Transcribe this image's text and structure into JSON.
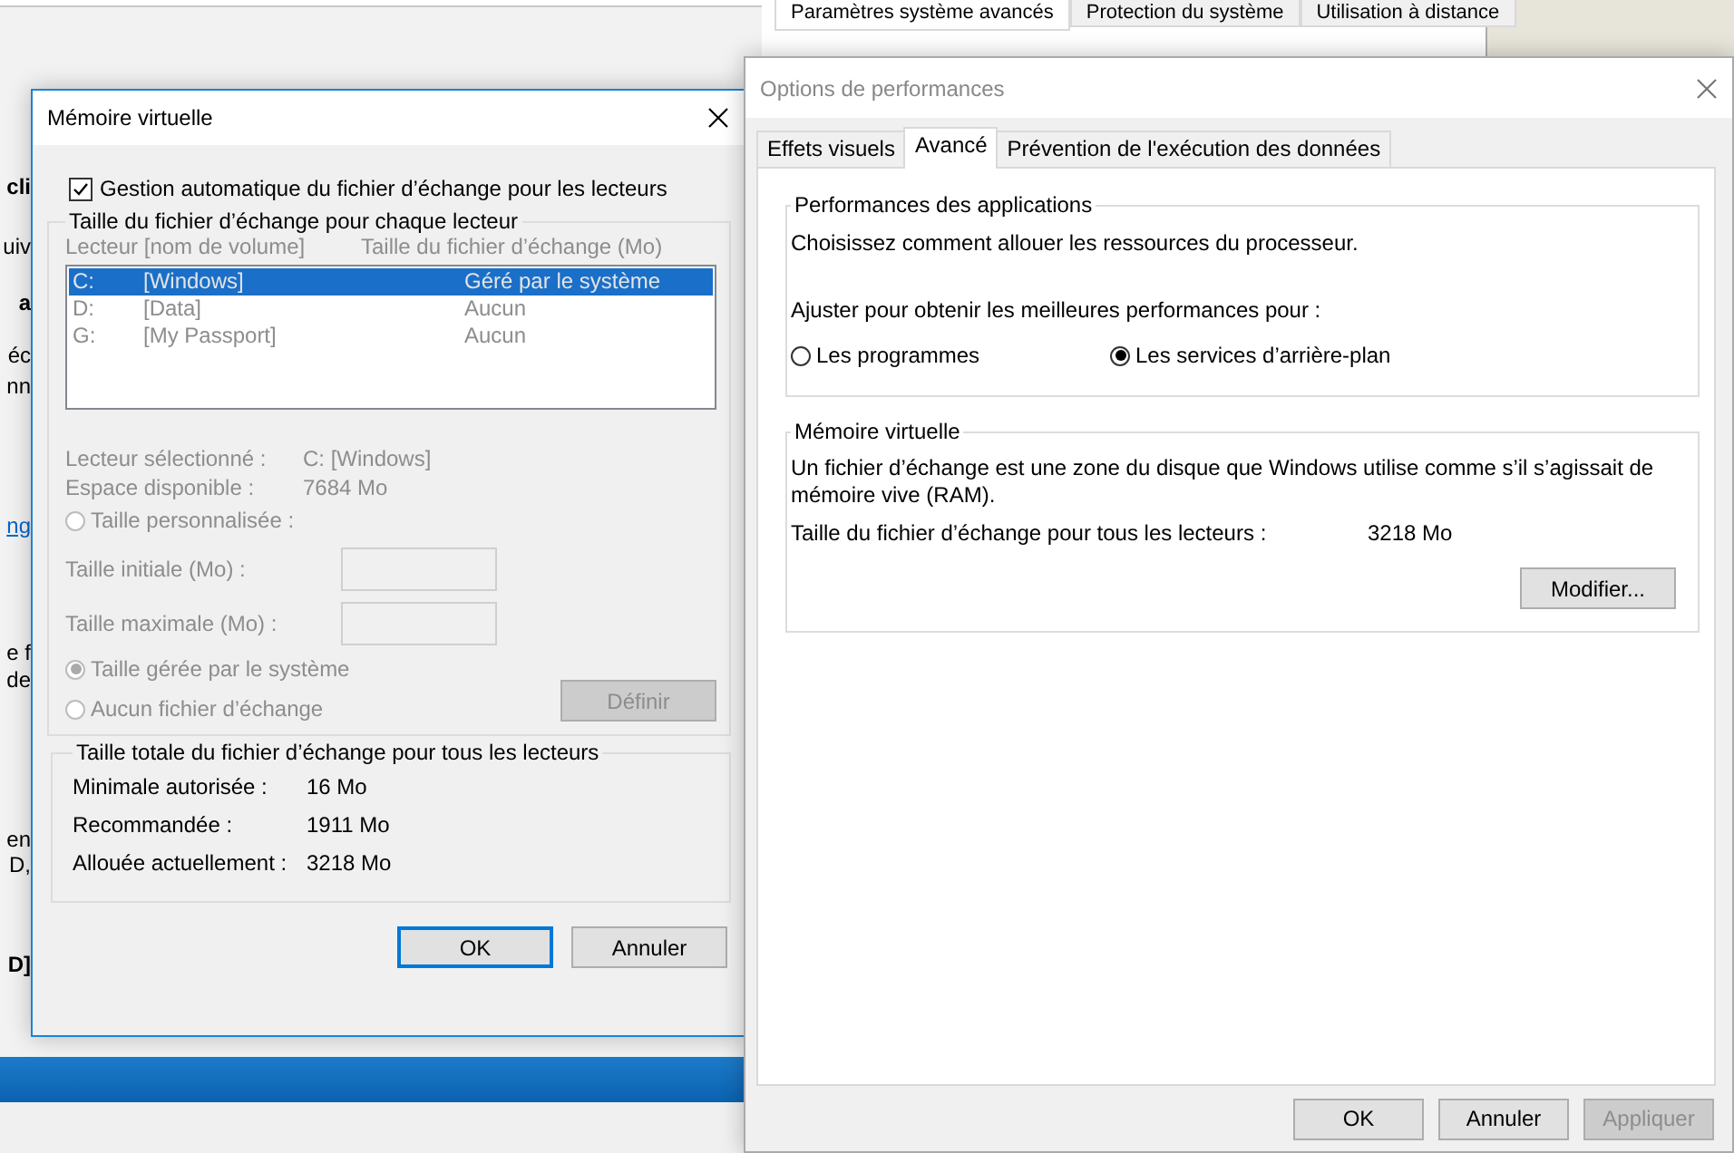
{
  "background_window": {
    "tabs": [
      {
        "label": "Paramètres système avancés",
        "selected": true
      },
      {
        "label": "Protection du système",
        "selected": false
      },
      {
        "label": "Utilisation à distance",
        "selected": false
      }
    ],
    "cut_texts": [
      {
        "text": "cli",
        "kind": "bold"
      },
      {
        "text": "uiv",
        "kind": "plain"
      },
      {
        "text": "a",
        "kind": "bold"
      },
      {
        "text": "éc",
        "kind": "plain"
      },
      {
        "text": "nn",
        "kind": "plain"
      },
      {
        "text": "ng",
        "kind": "link"
      },
      {
        "text": "e f",
        "kind": "plain"
      },
      {
        "text": "de",
        "kind": "plain"
      },
      {
        "text": "en",
        "kind": "plain"
      },
      {
        "text": "D,",
        "kind": "plain"
      },
      {
        "text": "D]",
        "kind": "bold"
      }
    ]
  },
  "virtual_memory_dialog": {
    "title": "Mémoire virtuelle",
    "auto_manage": {
      "label": "Gestion automatique du fichier d’échange pour les lecteurs",
      "checked": true
    },
    "drives_group": {
      "title": "Taille du fichier d’échange pour chaque lecteur",
      "columns": [
        "Lecteur [nom de volume]",
        "Taille du fichier d’échange (Mo)"
      ],
      "drives": [
        {
          "drive": "C:",
          "volume": "[Windows]",
          "size": "Géré par le système",
          "selected": true
        },
        {
          "drive": "D:",
          "volume": "[Data]",
          "size": "Aucun",
          "selected": false
        },
        {
          "drive": "G:",
          "volume": "[My Passport]",
          "size": "Aucun",
          "selected": false
        }
      ],
      "info": [
        {
          "label": "Lecteur sélectionné :",
          "value": "C:  [Windows]"
        },
        {
          "label": "Espace disponible :",
          "value": "7684 Mo"
        }
      ],
      "options": [
        {
          "label": "Taille personnalisée :",
          "selected": false
        },
        {
          "label": "Taille gérée par le système",
          "selected": true
        },
        {
          "label": "Aucun fichier d’échange",
          "selected": false
        }
      ],
      "size_fields": [
        {
          "label": "Taille initiale (Mo) :"
        },
        {
          "label": "Taille maximale (Mo) :"
        }
      ],
      "set_button": "Définir"
    },
    "totals_group": {
      "title": "Taille totale du fichier d’échange pour tous les lecteurs",
      "rows": [
        {
          "label": "Minimale autorisée :",
          "value": "16 Mo"
        },
        {
          "label": "Recommandée :",
          "value": "1911 Mo"
        },
        {
          "label": "Allouée actuellement :",
          "value": "3218 Mo"
        }
      ]
    },
    "buttons": [
      {
        "label": "OK",
        "default": true
      },
      {
        "label": "Annuler",
        "default": false
      }
    ]
  },
  "performance_dialog": {
    "title": "Options de performances",
    "tabs": [
      {
        "label": "Effets visuels",
        "selected": false
      },
      {
        "label": "Avancé",
        "selected": true
      },
      {
        "label": "Prévention de l'exécution des données",
        "selected": false
      }
    ],
    "app_group": {
      "title": "Performances des applications",
      "description": "Choisissez comment allouer les ressources du processeur.",
      "prompt": "Ajuster pour obtenir les meilleures performances pour :",
      "options": [
        {
          "label": "Les programmes",
          "selected": false
        },
        {
          "label": "Les services d’arrière-plan",
          "selected": true
        }
      ]
    },
    "vm_group": {
      "title": "Mémoire virtuelle",
      "description": "Un fichier d’échange est une zone du disque que Windows utilise comme s’il s’agissait de mémoire vive (RAM).",
      "size_label": "Taille du fichier d’échange pour tous les lecteurs :",
      "size_value": "3218 Mo",
      "modify_button": "Modifier..."
    },
    "buttons": [
      {
        "label": "OK",
        "disabled": false
      },
      {
        "label": "Annuler",
        "disabled": false
      },
      {
        "label": "Appliquer",
        "disabled": true
      }
    ]
  }
}
